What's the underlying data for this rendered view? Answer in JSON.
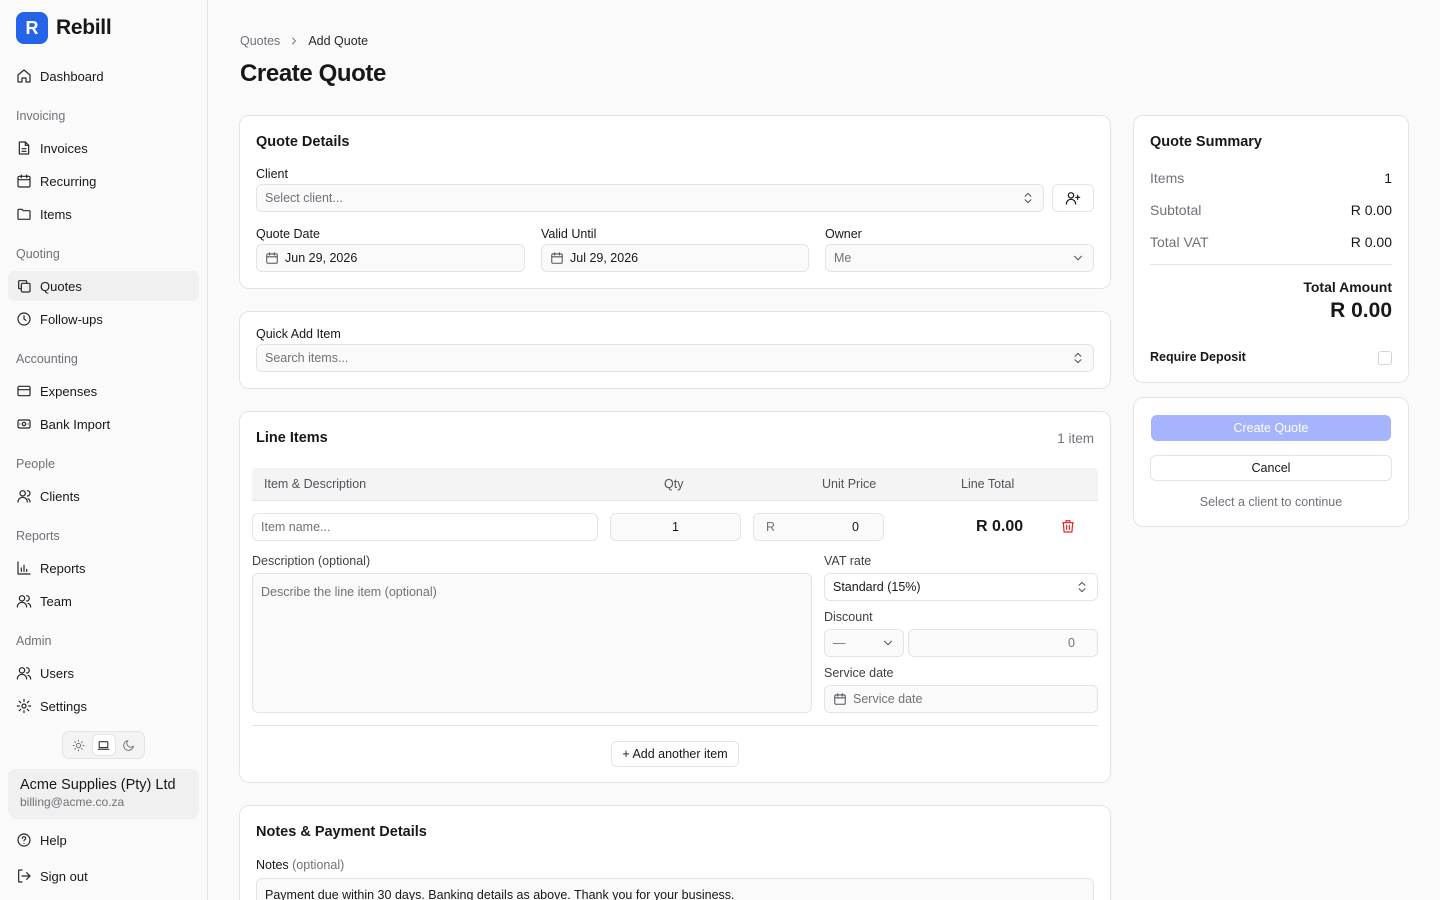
{
  "brand": {
    "logo_letter": "R",
    "name": "Rebill",
    "accent": "#2563eb"
  },
  "sidebar": {
    "dashboard": "Dashboard",
    "groups": {
      "invoicing": "Invoicing",
      "quoting": "Quoting",
      "accounting": "Accounting",
      "people": "People",
      "reports": "Reports",
      "admin": "Admin"
    },
    "items": {
      "invoices": "Invoices",
      "recurring": "Recurring",
      "items": "Items",
      "quotes": "Quotes",
      "followups": "Follow-ups",
      "expenses": "Expenses",
      "bank_import": "Bank Import",
      "clients": "Clients",
      "reports": "Reports",
      "team": "Team",
      "users": "Users",
      "settings": "Settings"
    },
    "theme_selected": "system",
    "account": {
      "name": "Acme Supplies (Pty) Ltd",
      "email": "billing@acme.co.za"
    },
    "help": "Help",
    "sign_out": "Sign out"
  },
  "breadcrumb": {
    "parent": "Quotes",
    "current": "Add Quote"
  },
  "page_title": "Create Quote",
  "quote_details": {
    "title": "Quote Details",
    "client_label": "Client",
    "client_placeholder": "Select client...",
    "quote_date_label": "Quote Date",
    "quote_date": "Jun 29, 2026",
    "valid_until_label": "Valid Until",
    "valid_until": "Jul 29, 2026",
    "owner_label": "Owner",
    "owner": "Me"
  },
  "quick_add": {
    "label": "Quick Add Item",
    "placeholder": "Search items..."
  },
  "line_items": {
    "title": "Line Items",
    "count": "1 item",
    "columns": {
      "item": "Item & Description",
      "qty": "Qty",
      "unit_price": "Unit Price",
      "line_total": "Line Total"
    },
    "row": {
      "name_placeholder": "Item name...",
      "qty": "1",
      "currency": "R",
      "unit_price": "0",
      "line_total": "R 0.00",
      "description_label": "Description (optional)",
      "description_placeholder": "Describe the line item (optional)",
      "vat_label": "VAT rate",
      "vat_value": "Standard (15%)",
      "discount_label": "Discount",
      "discount_type": "—",
      "discount_value": "0",
      "service_date_label": "Service date",
      "service_date_placeholder": "Service date"
    },
    "add_another": "+ Add another item"
  },
  "notes": {
    "title": "Notes & Payment Details",
    "notes_label": "Notes",
    "notes_optional": "(optional)",
    "notes_value": "Payment due within 30 days. Banking details as above. Thank you for your business."
  },
  "summary": {
    "title": "Quote Summary",
    "items_label": "Items",
    "items_value": "1",
    "subtotal_label": "Subtotal",
    "subtotal_value": "R 0.00",
    "vat_label": "Total VAT",
    "vat_value": "R 0.00",
    "total_label": "Total Amount",
    "total_value": "R 0.00",
    "deposit_label": "Require Deposit"
  },
  "actions": {
    "create": "Create Quote",
    "cancel": "Cancel",
    "hint": "Select a client to continue",
    "create_color": "#a5b4fc"
  }
}
